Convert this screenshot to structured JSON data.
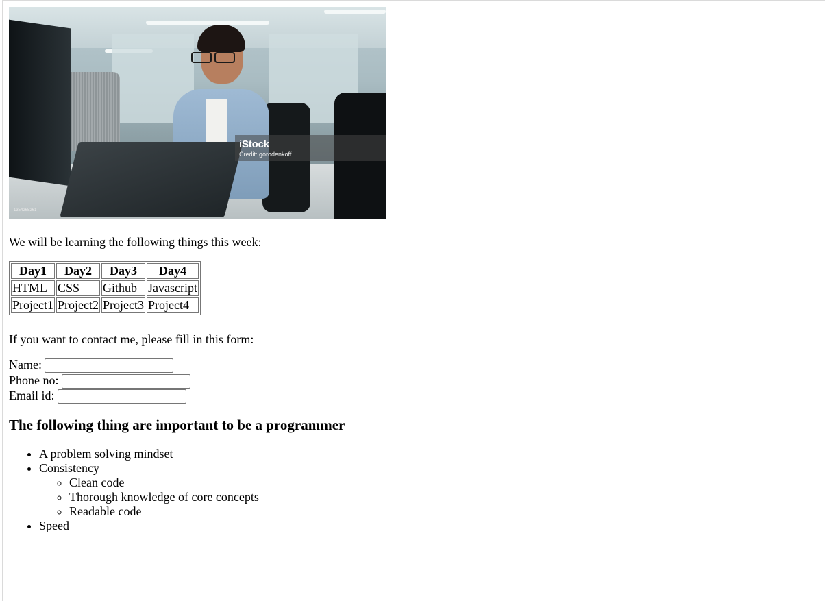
{
  "image": {
    "watermark_brand": "iStock",
    "watermark_credit": "Credit: gorodenkoff",
    "image_id_label": "1354265261"
  },
  "intro_text": "We will be learning the following things this week:",
  "schedule": {
    "headers": [
      "Day1",
      "Day2",
      "Day3",
      "Day4"
    ],
    "rows": [
      [
        "HTML",
        "CSS",
        "Github",
        "Javascript"
      ],
      [
        "Project1",
        "Project2",
        "Project3",
        "Project4"
      ]
    ]
  },
  "contact_text": "If you want to contact me, please fill in this form:",
  "form": {
    "name_label": "Name:",
    "name_value": "",
    "phone_label": "Phone no:",
    "phone_value": "",
    "email_label": "Email id:",
    "email_value": ""
  },
  "heading": "The following thing are important to be a programmer",
  "topics": {
    "items": [
      "A problem solving mindset",
      "Consistency",
      "Speed"
    ],
    "sub_items": [
      "Clean code",
      "Thorough knowledge of core concepts",
      "Readable code"
    ]
  }
}
